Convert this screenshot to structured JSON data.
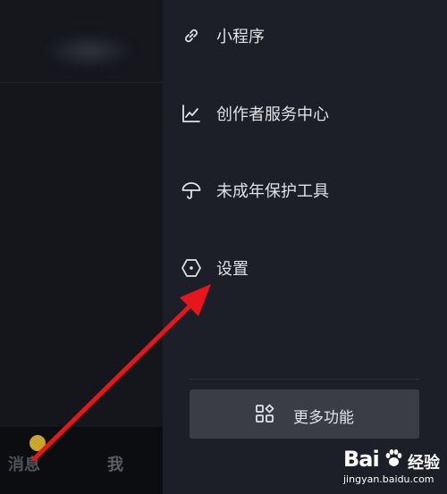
{
  "left": {
    "tabs": {
      "messages": "消息",
      "me": "我"
    },
    "badge": ""
  },
  "drawer": {
    "items": [
      {
        "label": "小程序",
        "icon": "link-icon"
      },
      {
        "label": "创作者服务中心",
        "icon": "chart-line-icon"
      },
      {
        "label": "未成年保护工具",
        "icon": "umbrella-icon"
      },
      {
        "label": "设置",
        "icon": "settings-hexagon-icon"
      }
    ],
    "more_button": {
      "label": "更多功能",
      "icon": "grid-apps-icon"
    }
  },
  "watermark": {
    "brand": "Bai",
    "brand_cn": "经验",
    "url": "jingyan.baidu.com"
  },
  "colors": {
    "annotation_arrow": "#e8161c",
    "accent_badge": "#c9a52a"
  }
}
